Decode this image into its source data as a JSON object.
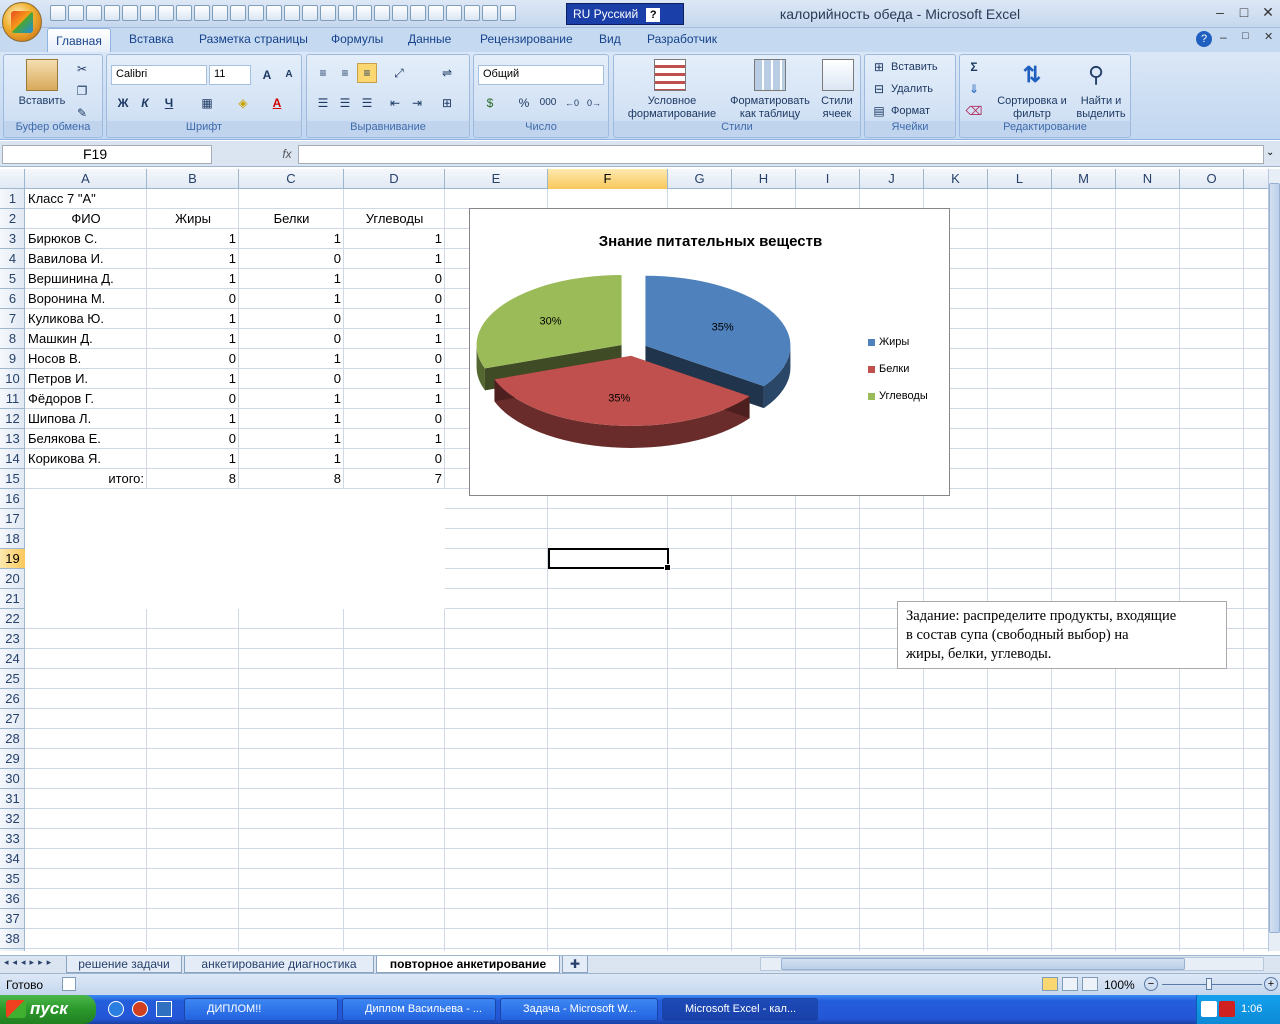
{
  "window": {
    "title": "калорийность обеда - Microsoft Excel",
    "lang_indicator": "RU Русский",
    "help_glyph": "?",
    "minimize": "–",
    "maximize": "□",
    "close": "✕"
  },
  "ribbon": {
    "tabs": [
      "Главная",
      "Вставка",
      "Разметка страницы",
      "Формулы",
      "Данные",
      "Рецензирование",
      "Вид",
      "Разработчик"
    ],
    "groups": {
      "clipboard": {
        "label": "Буфер обмена",
        "paste": "Вставить"
      },
      "font": {
        "label": "Шрифт",
        "font_name": "Calibri",
        "font_size": "11",
        "bold": "Ж",
        "italic": "К",
        "underline": "Ч",
        "grow": "A",
        "shrink": "A"
      },
      "align": {
        "label": "Выравнивание"
      },
      "number": {
        "label": "Число",
        "format": "Общий",
        "percent": "%",
        "thousands": "000"
      },
      "styles": {
        "label": "Стили",
        "cond": "Условное форматирование",
        "table": "Форматировать как таблицу",
        "cellstyles": "Стили ячеек"
      },
      "cells": {
        "label": "Ячейки",
        "insert": "Вставить",
        "delete": "Удалить",
        "format": "Формат"
      },
      "editing": {
        "label": "Редактирование",
        "sigma": "Σ",
        "sort": "Сортировка и фильтр",
        "find": "Найти и выделить"
      }
    }
  },
  "formula_bar": {
    "name_box": "F19",
    "fx": "fx",
    "value": ""
  },
  "columns": [
    "A",
    "B",
    "C",
    "D",
    "E",
    "F",
    "G",
    "H",
    "I",
    "J",
    "K",
    "L",
    "M",
    "N",
    "O"
  ],
  "selected_col": "F",
  "selected_row": 19,
  "rows": [
    "1",
    "2",
    "3",
    "4",
    "5",
    "6",
    "7",
    "8",
    "9",
    "10",
    "11",
    "12",
    "13",
    "14",
    "15",
    "16",
    "17",
    "18",
    "19",
    "20",
    "21",
    "22",
    "23",
    "24",
    "25",
    "26",
    "27",
    "28",
    "29",
    "30",
    "31",
    "32",
    "33",
    "34",
    "35",
    "36",
    "37",
    "38"
  ],
  "sheet": {
    "a1": "Класс 7 \"А\"",
    "headers": [
      "ФИО",
      "Жиры",
      "Белки",
      "Углеводы"
    ],
    "students": [
      [
        "Бирюков С.",
        "1",
        "1",
        "1"
      ],
      [
        "Вавилова И.",
        "1",
        "0",
        "1"
      ],
      [
        "Вершинина Д.",
        "1",
        "1",
        "0"
      ],
      [
        "Воронина М.",
        "0",
        "1",
        "0"
      ],
      [
        "Куликова Ю.",
        "1",
        "0",
        "1"
      ],
      [
        "Машкин Д.",
        "1",
        "0",
        "1"
      ],
      [
        "Носов В.",
        "0",
        "1",
        "0"
      ],
      [
        "Петров И.",
        "1",
        "0",
        "1"
      ],
      [
        "Фёдоров Г.",
        "0",
        "1",
        "1"
      ],
      [
        "Шипова Л.",
        "1",
        "1",
        "0"
      ],
      [
        "Белякова Е.",
        "0",
        "1",
        "1"
      ],
      [
        "Корикова Я.",
        "1",
        "1",
        "0"
      ]
    ],
    "totals": [
      "итого:",
      "8",
      "8",
      "7"
    ]
  },
  "chart_data": {
    "type": "pie",
    "title": "Знание питательных веществ",
    "categories": [
      "Жиры",
      "Белки",
      "Углеводы"
    ],
    "values": [
      8,
      8,
      7
    ],
    "data_labels": [
      "35%",
      "35%",
      "30%"
    ],
    "colors": [
      "#4f81bd",
      "#c0504d",
      "#9bbb59"
    ],
    "legend": "right",
    "exploded": true,
    "three_d": true
  },
  "task_text": [
    "Задание: распределите продукты, входящие",
    "в состав супа (свободный выбор) на",
    "жиры, белки, углеводы."
  ],
  "sheet_tabs": [
    "решение задачи",
    "анкетирование диагностика",
    "повторное анкетирование"
  ],
  "active_sheet": "повторное анкетирование",
  "status": {
    "ready": "Готово",
    "zoom": "100%"
  },
  "taskbar": {
    "start": "пуск",
    "tasks": [
      "ДИПЛОМ!!",
      "Диплом Васильева - ...",
      "Задача - Microsoft W...",
      "Microsoft Excel - кал..."
    ],
    "clock": "1:06"
  }
}
